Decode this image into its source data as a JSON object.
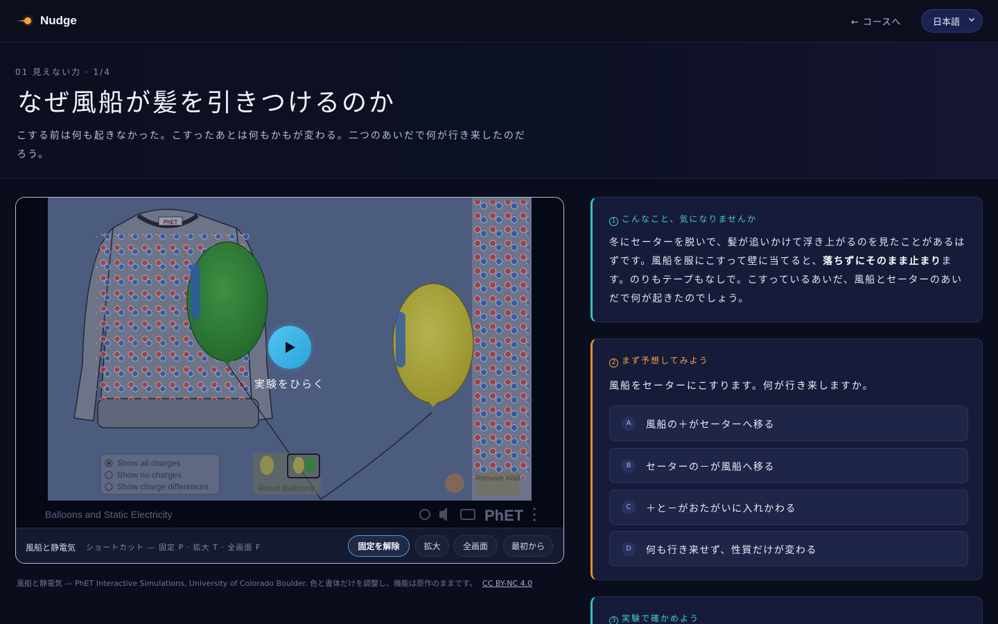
{
  "brand": {
    "name": "Nudge"
  },
  "nav": {
    "back_label": "← コースへ",
    "language": "日本語"
  },
  "lesson": {
    "eyebrow": "01 見えない力 · 1/4",
    "title": "なぜ風船が髪を引きつけるのか",
    "lead": "こする前は何も起きなかった。こすったあとは何もかもが変わる。二つのあいだで何が行き来したのだろう。"
  },
  "player": {
    "play_label": "実験をひらく",
    "sim": {
      "title": "Balloons and Static Electricity",
      "sweater_label": "PhET",
      "radio_options": [
        "Show all charges",
        "Show no charges",
        "Show charge differences"
      ],
      "reset_label": "Reset Balloons",
      "remove_wall_label": "Remove Wall",
      "phet_logo": "PhET"
    },
    "bar_title": "風船と静電気",
    "shortcuts": "ショートカット — 固定 P · 拡大 T · 全画面 F",
    "buttons": {
      "unpin": "固定を解除",
      "zoom": "拡大",
      "fullscreen": "全画面",
      "restart": "最初から"
    }
  },
  "credit": {
    "text": "風船と静電気 — PhET Interactive Simulations, University of Colorado Boulder. 色と書体だけを調整し、機能は原作のままです。",
    "license": "CC BY-NC 4.0"
  },
  "cards": {
    "hook": {
      "number": "1",
      "heading": "こんなこと、気になりませんか",
      "body_before": "冬にセーターを脱いで、髪が追いかけて浮き上がるのを見たことがあるはずです。風船を服にこすって壁に当てると、",
      "body_strong": "落ちずにそのまま止まり",
      "body_after": "ます。のりもテープもなしで。こすっているあいだ、風船とセーターのあいだで何が起きたのでしょう。"
    },
    "predict": {
      "number": "2",
      "heading": "まず予想してみよう",
      "question": "風船をセーターにこすります。何が行き来しますか。",
      "options": [
        {
          "key": "A",
          "text": "風船の＋がセーターへ移る"
        },
        {
          "key": "B",
          "text": "セーターの－が風船へ移る"
        },
        {
          "key": "C",
          "text": "＋と－がおたがいに入れかわる"
        },
        {
          "key": "D",
          "text": "何も行き来せず、性質だけが変わる"
        }
      ]
    },
    "experiment": {
      "number": "3",
      "heading": "実験で確かめよう"
    }
  },
  "colors": {
    "teal": "#3fd1c4",
    "amber": "#f0a444",
    "play": "#2aa3d8",
    "balloon_green": "#3aa53a",
    "balloon_yellow": "#e8e04a"
  }
}
